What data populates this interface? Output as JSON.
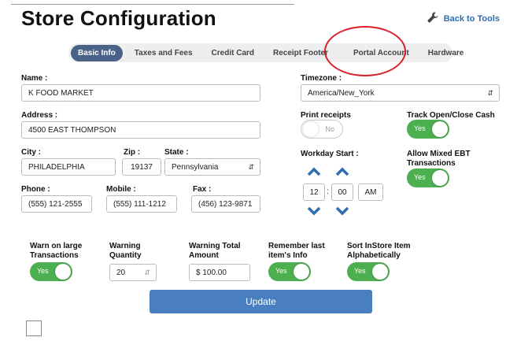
{
  "header": {
    "title": "Store Configuration",
    "back_link": "Back to Tools"
  },
  "tabs": [
    {
      "label": "Basic Info",
      "active": true
    },
    {
      "label": "Taxes and Fees",
      "active": false
    },
    {
      "label": "Credit Card",
      "active": false
    },
    {
      "label": "Receipt Footer",
      "active": false
    },
    {
      "label": "Portal Account",
      "active": false
    },
    {
      "label": "Hardware",
      "active": false
    }
  ],
  "form": {
    "name": {
      "label": "Name :",
      "value": "K FOOD MARKET"
    },
    "address": {
      "label": "Address :",
      "value": "4500 EAST THOMPSON"
    },
    "city": {
      "label": "City :",
      "value": "PHILADELPHIA"
    },
    "zip": {
      "label": "Zip :",
      "value": "19137"
    },
    "state": {
      "label": "State :",
      "value": "Pennsylvania"
    },
    "phone": {
      "label": "Phone :",
      "value": "(555) 121-2555"
    },
    "mobile": {
      "label": "Mobile :",
      "value": "(555) 111-1212"
    },
    "fax": {
      "label": "Fax :",
      "value": "(456) 123-9871"
    },
    "timezone": {
      "label": "Timezone :",
      "value": "America/New_York"
    },
    "print_receipts": {
      "label": "Print receipts",
      "state": "No"
    },
    "track_open_close": {
      "label": "Track Open/Close Cash",
      "state": "Yes"
    },
    "workday_start": {
      "label": "Workday Start :",
      "hour": "12",
      "separator": ":",
      "minute": "00",
      "ampm": "AM"
    },
    "allow_mixed_ebt": {
      "label": "Allow Mixed EBT Transactions",
      "state": "Yes"
    },
    "warn_large": {
      "label": "Warn on large Transactions",
      "state": "Yes"
    },
    "warning_quantity": {
      "label": "Warning Quantity",
      "value": "20"
    },
    "warning_total": {
      "label": "Warning Total Amount",
      "value": "$ 100.00"
    },
    "remember_last": {
      "label": "Remember last item's Info",
      "state": "Yes"
    },
    "sort_instore": {
      "label": "Sort InStore Item Alphabetically",
      "state": "Yes"
    }
  },
  "actions": {
    "update_label": "Update"
  },
  "colors": {
    "active_tab": "#4a6287",
    "toggle_on": "#4caf50",
    "update_button": "#4a7fbf",
    "link": "#2e6fb0",
    "highlight_circle": "#d8212a"
  }
}
